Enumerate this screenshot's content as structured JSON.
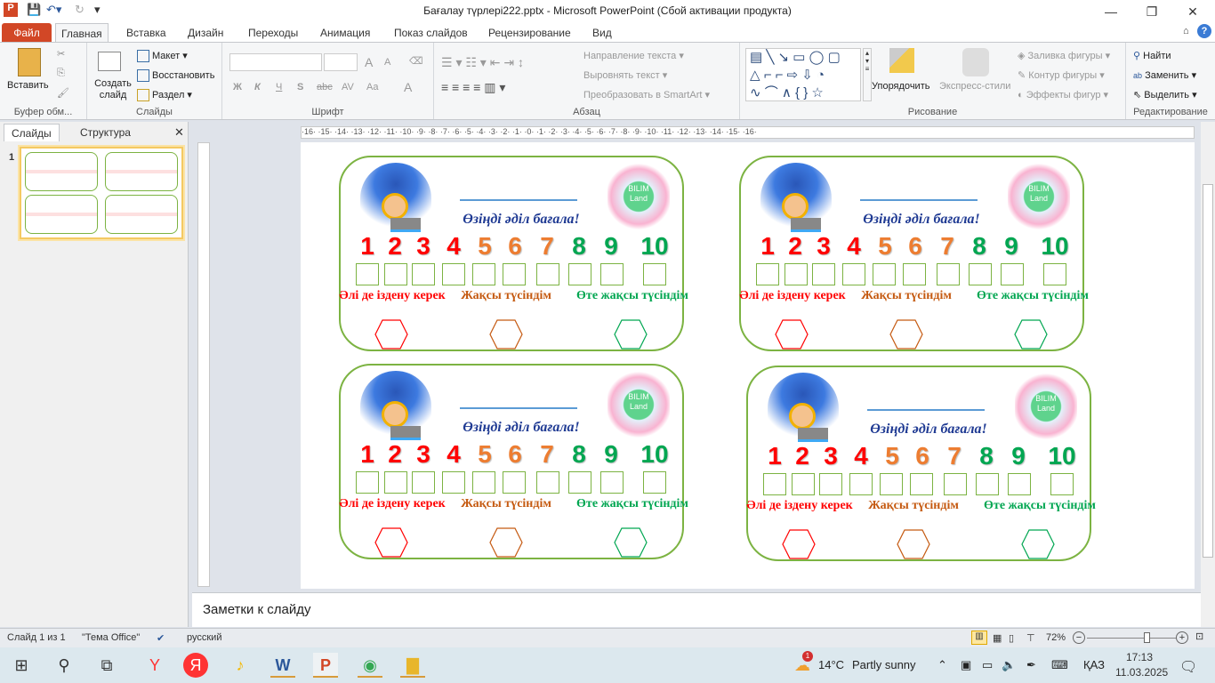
{
  "window": {
    "title": "Бағалау түрлері222.pptx  -  Microsoft PowerPoint (Сбой активации продукта)",
    "minimize": "—",
    "restore": "❐",
    "close": "✕"
  },
  "tabs": [
    "Файл",
    "Главная",
    "Вставка",
    "Дизайн",
    "Переходы",
    "Анимация",
    "Показ слайдов",
    "Рецензирование",
    "Вид"
  ],
  "ribbon": {
    "clipboard": {
      "paste": "Вставить",
      "label": "Буфер обм..."
    },
    "slides": {
      "new_slide": "Создать слайд",
      "layout": "Макет",
      "reset": "Восстановить",
      "section": "Раздел",
      "label": "Слайды"
    },
    "font": {
      "bold": "Ж",
      "italic": "К",
      "underline": "Ч",
      "shadow": "S",
      "strike": "abc",
      "spacing": "AV",
      "case": "Aa",
      "color": "A",
      "grow": "A",
      "shrink": "A",
      "label": "Шрифт"
    },
    "paragraph": {
      "text_direction": "Направление текста",
      "align_text": "Выровнять текст",
      "smartart": "Преобразовать в SmartArt",
      "label": "Абзац"
    },
    "drawing": {
      "arrange": "Упорядочить",
      "quick_styles": "Экспресс-стили",
      "fill": "Заливка фигуры",
      "outline": "Контур фигуры",
      "effects": "Эффекты фигур",
      "label": "Рисование"
    },
    "editing": {
      "find": "Найти",
      "replace": "Заменить",
      "select": "Выделить",
      "label": "Редактирование"
    }
  },
  "left_pane": {
    "tabs": [
      "Слайды",
      "Структура"
    ],
    "slide_number": "1"
  },
  "ruler_ticks": "·16· ·15· ·14· ·13· ·12· ·11· ·10· ·9· ·8· ·7· ·6· ·5· ·4· ·3· ·2· ·1· ·0· ·1· ·2· ·3· ·4· ·5· ·6· ·7· ·8· ·9· ·10· ·11· ·12· ·13· ·14· ·15· ·16·",
  "card": {
    "motto": "Өзіңді әділ бағала!",
    "logo": "BILIM Land",
    "numbers": [
      "1",
      "2",
      "3",
      "4",
      "5",
      "6",
      "7",
      "8",
      "9",
      "10"
    ],
    "number_colors": [
      "#ff0000",
      "#ff0000",
      "#ff0000",
      "#ff0000",
      "#ed7d31",
      "#ed7d31",
      "#ed7d31",
      "#00a651",
      "#00a651",
      "#00a651"
    ],
    "labels": [
      {
        "text": "Әлі де іздену керек",
        "color": "#ff0000"
      },
      {
        "text": "Жақсы түсіндім",
        "color": "#c55a11"
      },
      {
        "text": "Өте жақсы түсіндім",
        "color": "#00a651"
      }
    ]
  },
  "notes": {
    "placeholder": "Заметки к слайду"
  },
  "status": {
    "slide": "Слайд 1 из 1",
    "theme": "\"Тема Office\"",
    "language": "русский",
    "zoom": "72%",
    "zoom_value": 72
  },
  "taskbar": {
    "weather_temp": "14°C",
    "weather_text": "Partly sunny",
    "weather_badge": "1",
    "language": "ҚАЗ",
    "time": "17:13",
    "date": "11.03.2025"
  }
}
